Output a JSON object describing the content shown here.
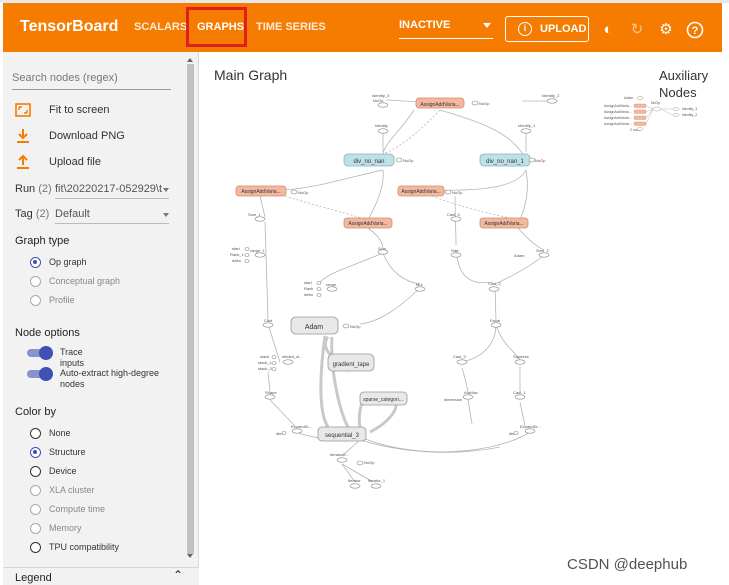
{
  "app": {
    "title": "TensorBoard",
    "nav": [
      "SCALARS",
      "GRAPHS",
      "TIME SERIES"
    ],
    "active_tab": "GRAPHS",
    "run_status": "INACTIVE",
    "upload_label": "UPLOAD",
    "header_icons": [
      "theme-icon",
      "refresh-icon",
      "settings-icon",
      "help-icon"
    ],
    "accent_color": "#f57c00",
    "highlight_color": "#e02020"
  },
  "sidebar": {
    "search_placeholder": "Search nodes (regex)",
    "actions": [
      {
        "label": "Fit to screen",
        "icon": "fit-screen-icon"
      },
      {
        "label": "Download PNG",
        "icon": "download-icon"
      },
      {
        "label": "Upload file",
        "icon": "upload-icon"
      }
    ],
    "run": {
      "label": "Run",
      "count": "(2)",
      "value": "fit\\20220217-052929\\t"
    },
    "tag": {
      "label": "Tag",
      "count": "(2)",
      "value": "Default"
    },
    "graph_type": {
      "title": "Graph type",
      "options": [
        "Op graph",
        "Conceptual graph",
        "Profile"
      ],
      "selected": "Op graph"
    },
    "node_options": {
      "title": "Node options",
      "toggles": [
        "Trace inputs",
        "Auto-extract high-degree nodes"
      ]
    },
    "color_by": {
      "title": "Color by",
      "options": [
        "None",
        "Structure",
        "Device",
        "XLA cluster",
        "Compute time",
        "Memory",
        "TPU compatibility"
      ],
      "selected": "Structure"
    },
    "legend_label": "Legend"
  },
  "graph": {
    "main_title": "Main Graph",
    "aux_title": "Auxiliary Nodes",
    "nodes": {
      "assign_1": "AssignAddVaria...",
      "div_no_nan": "div_no_nan",
      "div_no_nan_1": "div_no_nan_1",
      "assign_2": "AssignAddVaria...",
      "assign_3": "AssignAddVaria...",
      "assign_4": "AssignAddVaria...",
      "assign_5": "AssignAddVaria...",
      "adam": "Adam",
      "gradient_tape": "gradient_tape",
      "sparse_categorical": "sparse_categori...",
      "sequential_3": "sequential_3"
    },
    "small_labels": {
      "identity_3": "Identity_3",
      "identity_2": "Identity_2",
      "identity": "Identity",
      "identity_1": "Identity_1",
      "sum_1": "Sum_1",
      "cast_1": "Cast_1",
      "cast_4": "Cast_4",
      "sum": "Sum",
      "size": "Size",
      "sum_2": "Sum_2",
      "range_1": "range_1",
      "range": "range",
      "mul": "Mul",
      "cast_2": "Cast_2",
      "cast": "Cast",
      "equal": "Equal",
      "cast_3": "Cast_3",
      "squeeze": "Squeeze",
      "strided_slice": "strided_sl...",
      "argmax": "ArgMax",
      "shape": "Shape",
      "expand_dims": "ExpandDi...",
      "expand_dims_1": "ExpandDi...",
      "iterator": "IteratorG...",
      "iterator_1": "Iterator",
      "iterator_2": "Iterator_1",
      "dimension": "dimension",
      "nodep": "NoOp",
      "start": "start",
      "rank": "Rank",
      "delta": "delta",
      "rank_1": "Rank_1",
      "stack": "stack",
      "stack_1": "stack_1",
      "stack_2": "stack_2",
      "dim": "dim",
      "adam_small": "Adam",
      "more": "2 more"
    },
    "aux_labels": {
      "a1": "AssignAddVaria...",
      "a2": "AssignAddVaria...",
      "a3": "AssignAddVaria...",
      "a4": "AssignAddVaria...",
      "noop": "NoOp",
      "id3": "Identity_3",
      "id2": "Identity_2"
    }
  },
  "watermark": "CSDN @deephub"
}
